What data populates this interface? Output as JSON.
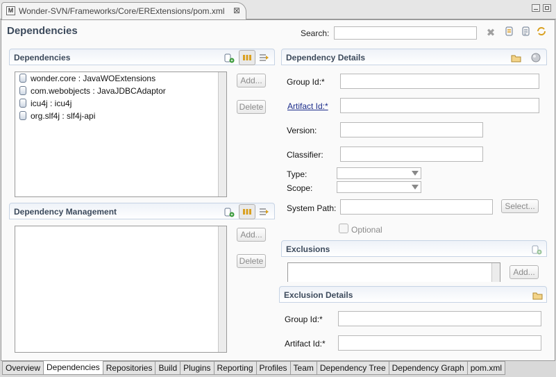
{
  "editor_tab": {
    "title": "Wonder-SVN/Frameworks/Core/ERExtensions/pom.xml",
    "file_icon_letter": "M"
  },
  "header": {
    "title": "Dependencies",
    "search_label": "Search:",
    "search_value": ""
  },
  "dependencies": {
    "title": "Dependencies",
    "items": [
      {
        "label": "wonder.core : JavaWOExtensions"
      },
      {
        "label": "com.webobjects : JavaJDBCAdaptor"
      },
      {
        "label": "icu4j : icu4j"
      },
      {
        "label": "org.slf4j : slf4j-api"
      }
    ],
    "add_label": "Add...",
    "delete_label": "Delete"
  },
  "dependency_management": {
    "title": "Dependency Management",
    "items": [],
    "add_label": "Add...",
    "delete_label": "Delete"
  },
  "dependency_details": {
    "title": "Dependency Details",
    "group_id_label": "Group Id:*",
    "artifact_id_label": "Artifact Id:*",
    "version_label": "Version:",
    "classifier_label": "Classifier:",
    "type_label": "Type:",
    "scope_label": "Scope:",
    "system_path_label": "System Path:",
    "select_label": "Select...",
    "optional_label": "Optional",
    "group_id_value": "",
    "artifact_id_value": "",
    "version_value": "",
    "classifier_value": "",
    "type_value": "",
    "scope_value": "",
    "system_path_value": ""
  },
  "exclusions": {
    "title": "Exclusions",
    "add_label": "Add..."
  },
  "exclusion_details": {
    "title": "Exclusion Details",
    "group_id_label": "Group Id:*",
    "artifact_id_label": "Artifact Id:*"
  },
  "bottom_tabs": [
    {
      "label": "Overview"
    },
    {
      "label": "Dependencies",
      "active": true
    },
    {
      "label": "Repositories"
    },
    {
      "label": "Build"
    },
    {
      "label": "Plugins"
    },
    {
      "label": "Reporting"
    },
    {
      "label": "Profiles"
    },
    {
      "label": "Team"
    },
    {
      "label": "Dependency Tree"
    },
    {
      "label": "Dependency Graph"
    },
    {
      "label": "pom.xml"
    }
  ]
}
